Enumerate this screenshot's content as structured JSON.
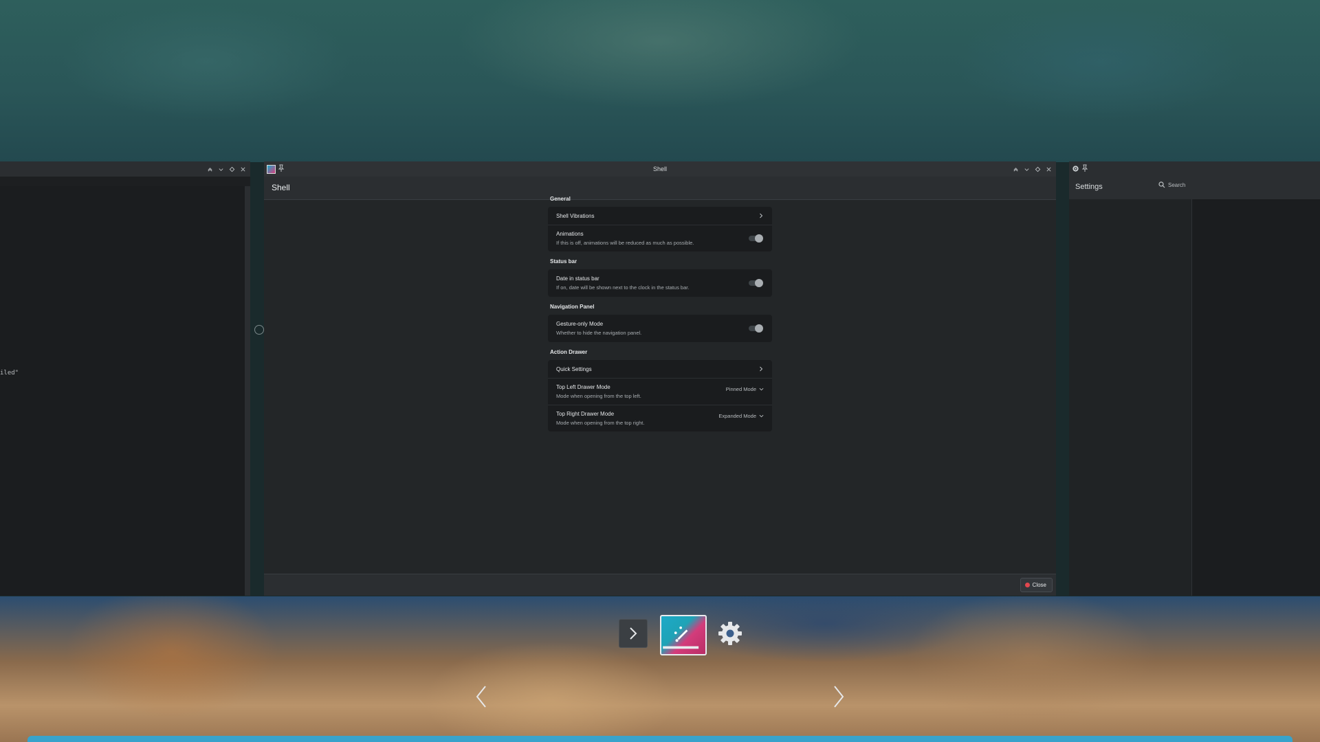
{
  "main_window": {
    "title": "Shell",
    "page_title": "Shell",
    "sections": [
      {
        "title": "General",
        "rows": [
          {
            "label": "Shell Vibrations",
            "type": "link"
          },
          {
            "label": "Animations",
            "description": "If this is off, animations will be reduced as much as possible.",
            "type": "toggle",
            "checked": true
          }
        ]
      },
      {
        "title": "Status bar",
        "rows": [
          {
            "label": "Date in status bar",
            "description": "If on, date will be shown next to the clock in the status bar.",
            "type": "toggle",
            "checked": true
          }
        ]
      },
      {
        "title": "Navigation Panel",
        "rows": [
          {
            "label": "Gesture-only Mode",
            "description": "Whether to hide the navigation panel.",
            "type": "toggle",
            "checked": true
          }
        ]
      },
      {
        "title": "Action Drawer",
        "rows": [
          {
            "label": "Quick Settings",
            "type": "link"
          },
          {
            "label": "Top Left Drawer Mode",
            "description": "Mode when opening from the top left.",
            "type": "combo",
            "value": "Pinned Mode"
          },
          {
            "label": "Top Right Drawer Mode",
            "description": "Mode when opening from the top right.",
            "type": "combo",
            "value": "Expanded Mode"
          }
        ]
      }
    ],
    "close_label": "Close"
  },
  "left_window": {
    "text_fragment": "iled\""
  },
  "right_window": {
    "page_title": "Settings",
    "search_placeholder": "Search"
  },
  "dock": {
    "items": [
      "terminal-icon",
      "discover-icon",
      "settings-gear-icon"
    ]
  },
  "colors": {
    "accent_close": "#e2474e",
    "bottom_glow": "#2ea7d8"
  }
}
